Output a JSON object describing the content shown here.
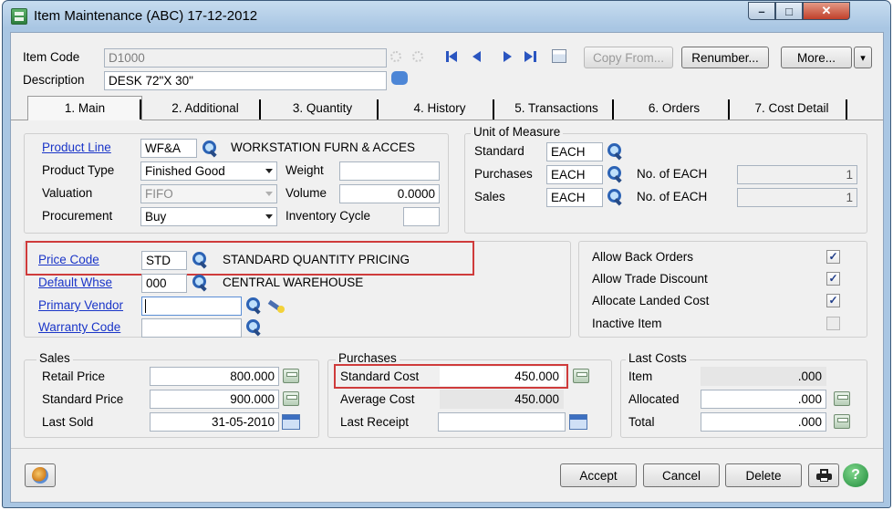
{
  "window": {
    "title": "Item Maintenance (ABC) 17-12-2012",
    "minimize": "–",
    "maximize": "□",
    "close": "✕"
  },
  "header": {
    "item_code_label": "Item Code",
    "item_code": "D1000",
    "description_label": "Description",
    "description": "DESK 72\"X 30\"",
    "copy_from": "Copy From...",
    "renumber": "Renumber...",
    "more": "More...",
    "more_arrow": "▾"
  },
  "tabs": [
    {
      "label": "1. Main"
    },
    {
      "label": "2. Additional"
    },
    {
      "label": "3. Quantity"
    },
    {
      "label": "4. History"
    },
    {
      "label": "5. Transactions"
    },
    {
      "label": "6. Orders"
    },
    {
      "label": "7. Cost Detail"
    }
  ],
  "main": {
    "product_line_label": "Product Line",
    "product_line": "WF&A",
    "product_line_desc": "WORKSTATION FURN & ACCES",
    "product_type_label": "Product Type",
    "product_type": "Finished Good",
    "valuation_label": "Valuation",
    "valuation": "FIFO",
    "procurement_label": "Procurement",
    "procurement": "Buy",
    "weight_label": "Weight",
    "weight": "",
    "volume_label": "Volume",
    "volume": "0.0000",
    "inventory_cycle_label": "Inventory Cycle",
    "inventory_cycle": ""
  },
  "uom": {
    "title": "Unit of Measure",
    "standard_label": "Standard",
    "standard": "EACH",
    "purchases_label": "Purchases",
    "purchases": "EACH",
    "purchases_no_label": "No. of EACH",
    "purchases_no": "1",
    "sales_label": "Sales",
    "sales": "EACH",
    "sales_no_label": "No. of EACH",
    "sales_no": "1"
  },
  "codes": {
    "price_code_label": "Price Code",
    "price_code": "STD",
    "price_code_desc": "STANDARD QUANTITY PRICING",
    "default_whse_label": "Default Whse",
    "default_whse": "000",
    "default_whse_desc": "CENTRAL WAREHOUSE",
    "primary_vendor_label": "Primary Vendor",
    "primary_vendor": "",
    "warranty_code_label": "Warranty Code",
    "warranty_code": ""
  },
  "flags": {
    "allow_back_orders": {
      "label": "Allow Back Orders",
      "checked": true
    },
    "allow_trade_discount": {
      "label": "Allow Trade Discount",
      "checked": true
    },
    "allocate_landed_cost": {
      "label": "Allocate Landed Cost",
      "checked": true
    },
    "inactive_item": {
      "label": "Inactive Item",
      "checked": false
    }
  },
  "sales": {
    "title": "Sales",
    "retail_price_label": "Retail Price",
    "retail_price": "800.000",
    "standard_price_label": "Standard Price",
    "standard_price": "900.000",
    "last_sold_label": "Last Sold",
    "last_sold": "31-05-2010"
  },
  "purchases": {
    "title": "Purchases",
    "standard_cost_label": "Standard Cost",
    "standard_cost": "450.000",
    "average_cost_label": "Average Cost",
    "average_cost": "450.000",
    "last_receipt_label": "Last Receipt",
    "last_receipt": ""
  },
  "last_costs": {
    "title": "Last Costs",
    "item_label": "Item",
    "item": ".000",
    "allocated_label": "Allocated",
    "allocated": ".000",
    "total_label": "Total",
    "total": ".000"
  },
  "footer": {
    "accept": "Accept",
    "cancel": "Cancel",
    "delete": "Delete"
  },
  "checkmark": "✓",
  "colors": {
    "link": "#1a35c8",
    "highlight": "#cf3b3b",
    "title_bar": "#a9c6e3",
    "close_button": "#c0402a"
  }
}
